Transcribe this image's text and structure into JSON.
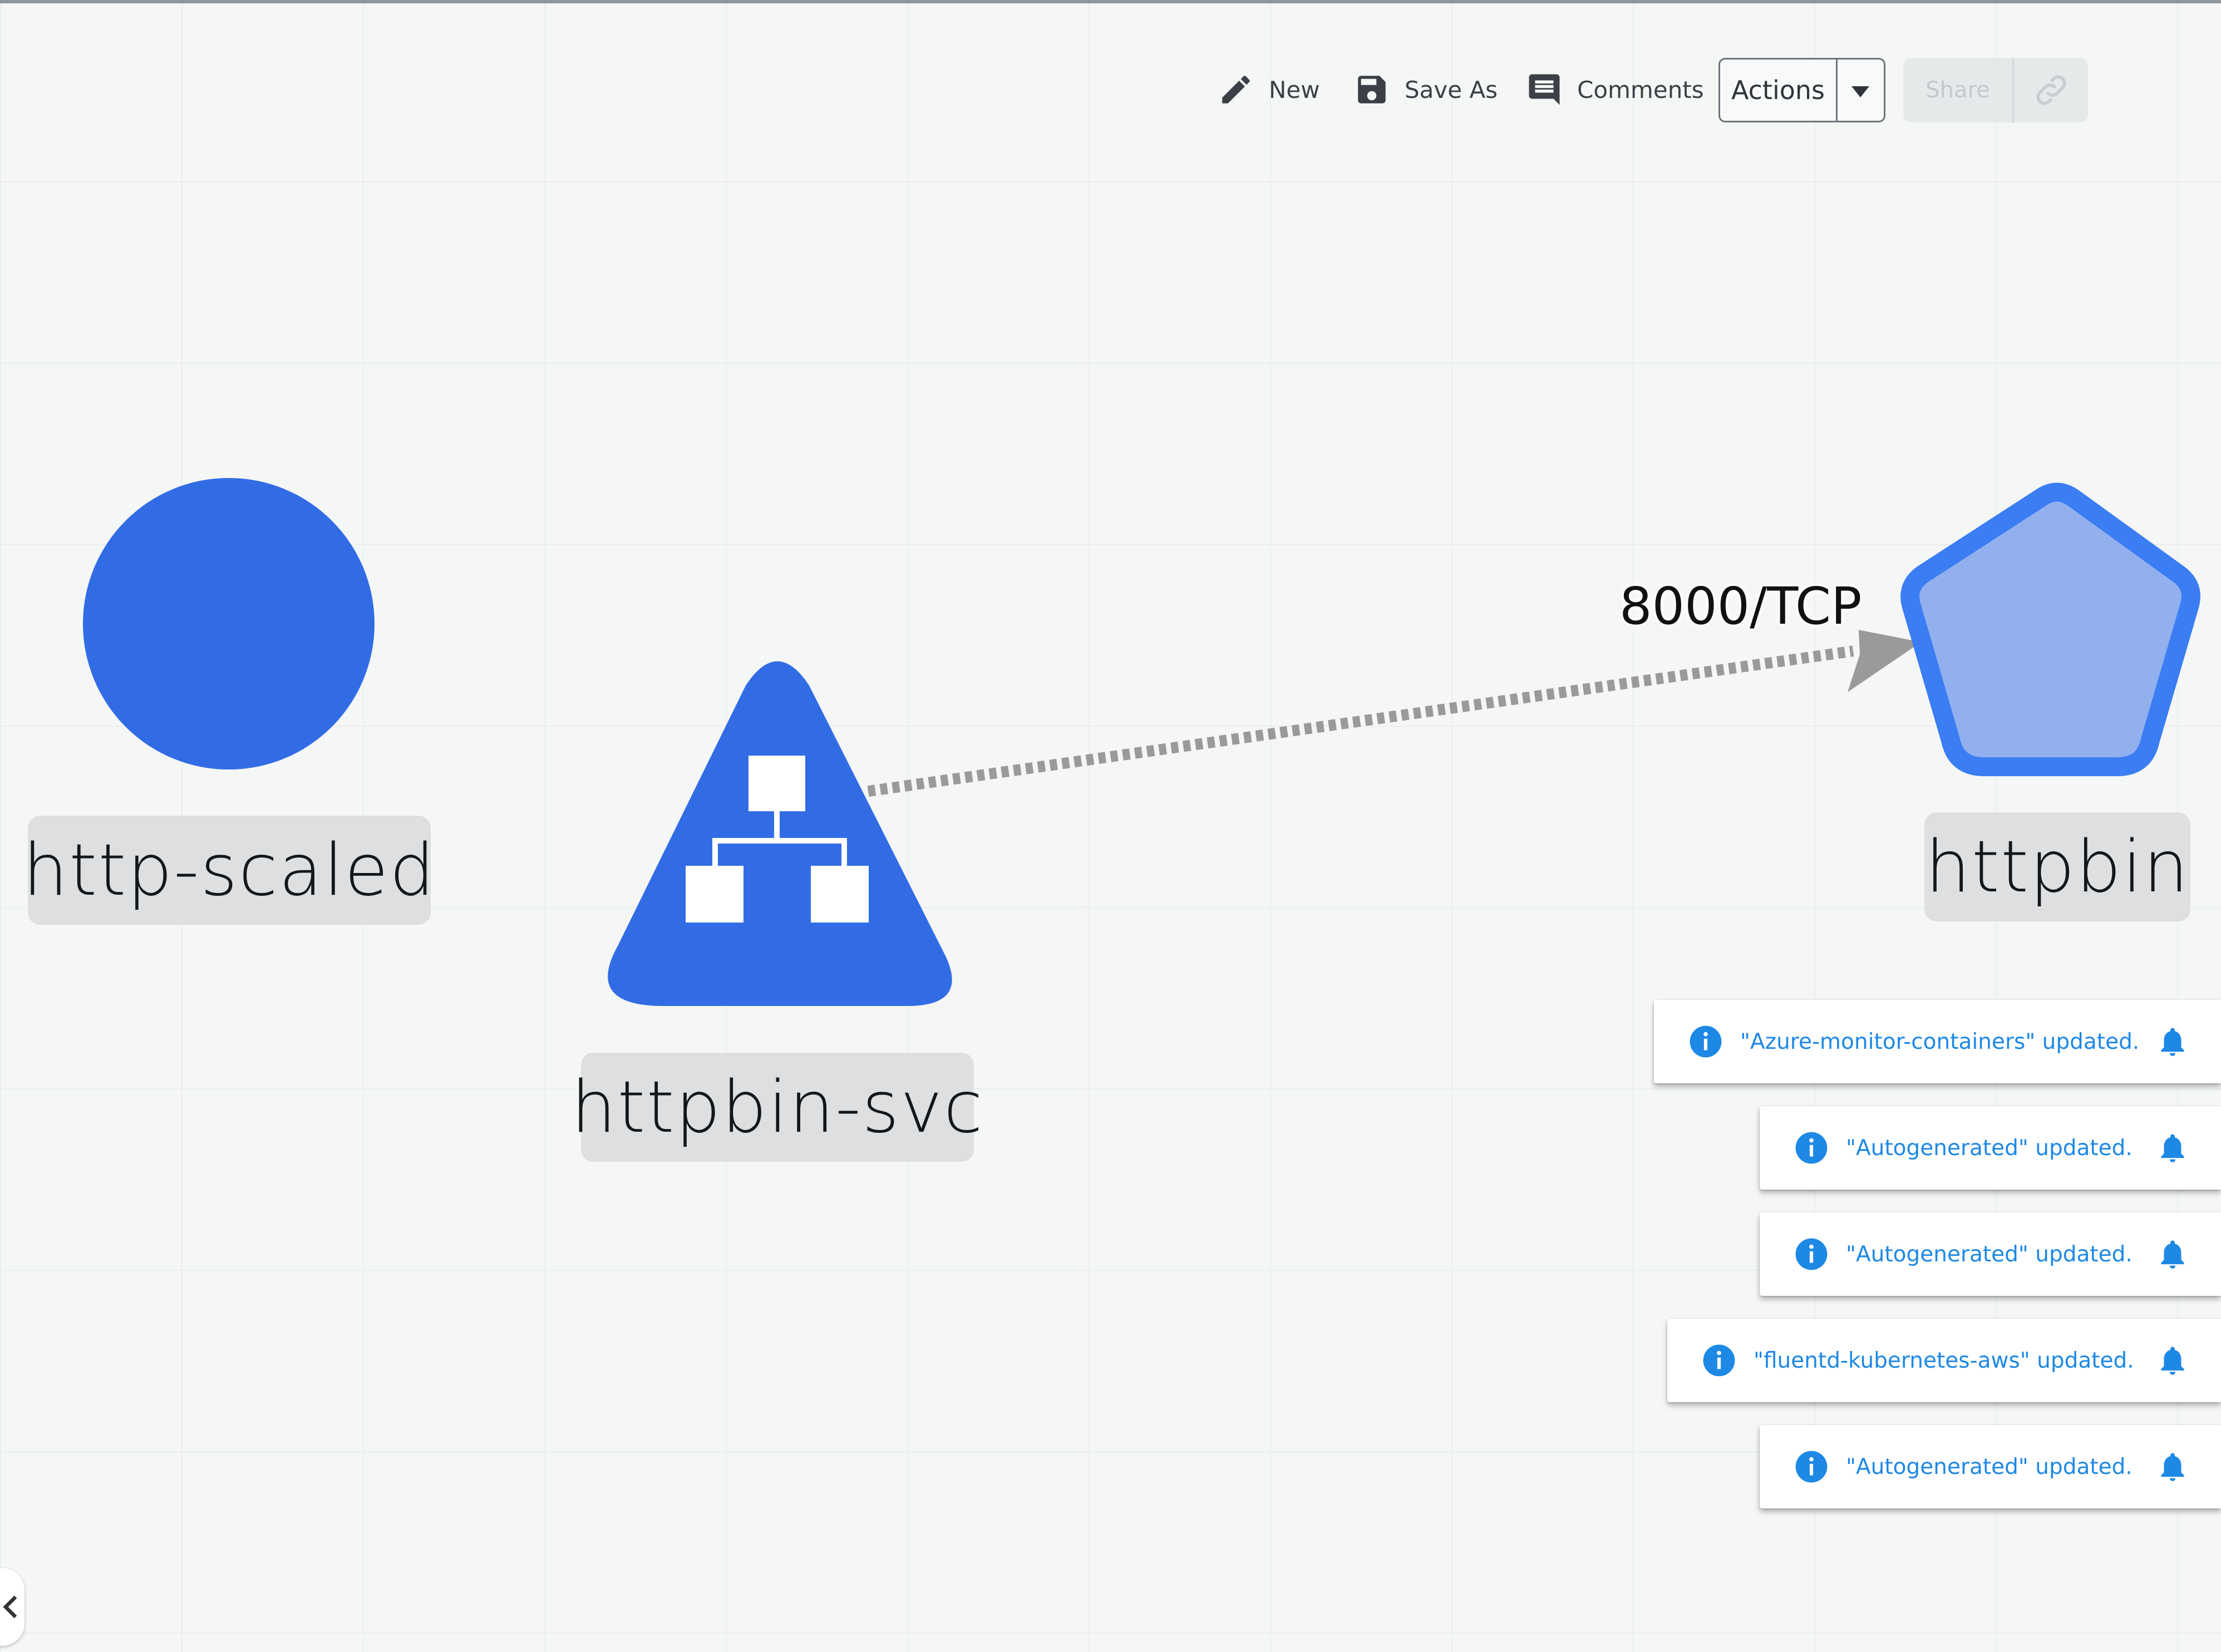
{
  "toolbar": {
    "new_label": "New",
    "save_as_label": "Save As",
    "comments_label": "Comments",
    "actions_label": "Actions",
    "share_label": "Share"
  },
  "nodes": {
    "http_scaled": {
      "label": "http-scaled",
      "shape": "circle",
      "icon": "circle-node"
    },
    "httpbin_svc": {
      "label": "httpbin-svc",
      "shape": "rounded-triangle",
      "icon": "sitemap-icon"
    },
    "httpbin": {
      "label": "httpbin",
      "shape": "pentagon",
      "icon": "pentagon-node"
    }
  },
  "edges": [
    {
      "from": "httpbin-svc",
      "to": "httpbin",
      "label": "8000/TCP",
      "style": "dashed"
    }
  ],
  "notifications": [
    {
      "text": "\"Azure-monitor-containers\" updated."
    },
    {
      "text": "\"Autogenerated\" updated."
    },
    {
      "text": "\"Autogenerated\" updated."
    },
    {
      "text": "\"fluentd-kubernetes-aws\" updated."
    },
    {
      "text": "\"Autogenerated\" updated."
    }
  ],
  "colors": {
    "node_blue": "#326ce5",
    "pentagon_fill": "#93b0ee",
    "pentagon_stroke": "#3b7df2",
    "edge_gray": "#9a9a9a",
    "notification_text": "#1e88e5",
    "canvas_bg": "#f5f7f6"
  }
}
